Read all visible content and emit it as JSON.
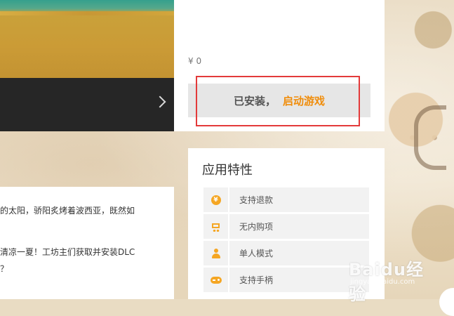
{
  "product": {
    "price": "¥ 0",
    "install_status": "已安装，",
    "launch_label": "启动游戏"
  },
  "description": {
    "lines": [
      "的太阳，骄阳炙烤着波西亚，既然如",
      "清凉一夏！工坊主们获取并安装DLC",
      "？"
    ]
  },
  "features": {
    "title": "应用特性",
    "items": [
      {
        "label": "支持退款",
        "icon": "refund-coin-icon"
      },
      {
        "label": "无内购项",
        "icon": "no-purchase-cart-icon"
      },
      {
        "label": "单人模式",
        "icon": "single-player-icon"
      },
      {
        "label": "支持手柄",
        "icon": "gamepad-icon"
      }
    ]
  },
  "watermark": {
    "text": "Baidu经验",
    "sub": "jingyan.baidu.com"
  },
  "colors": {
    "accent_orange": "#f08d0b",
    "icon_orange": "#f5a623",
    "highlight_red": "#e33a3a",
    "carousel_bar": "#262626"
  }
}
